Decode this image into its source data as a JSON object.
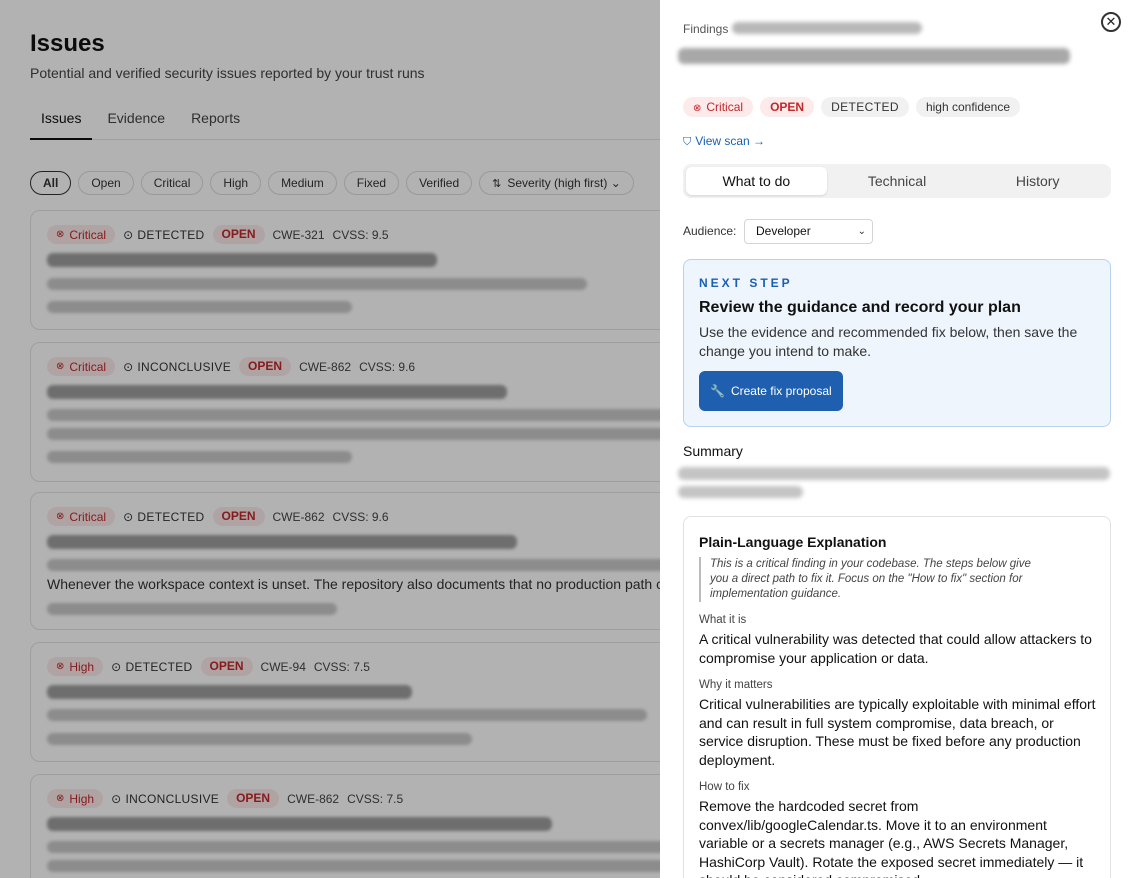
{
  "page": {
    "title": "Issues",
    "subtitle": "Potential and verified security issues reported by your trust runs",
    "tabs": [
      "Issues",
      "Evidence",
      "Reports"
    ],
    "filters": [
      "All",
      "Open",
      "Critical",
      "High",
      "Medium",
      "Fixed",
      "Verified"
    ],
    "sort_label": "Severity (high first)"
  },
  "cards": [
    {
      "severity": "Critical",
      "status": "DETECTED",
      "state": "OPEN",
      "cwe": "CWE-321",
      "cvss": "CVSS: 9.5"
    },
    {
      "severity": "Critical",
      "status": "INCONCLUSIVE",
      "state": "OPEN",
      "cwe": "CWE-862",
      "cvss": "CVSS: 9.6"
    },
    {
      "severity": "Critical",
      "status": "DETECTED",
      "state": "OPEN",
      "cwe": "CWE-862",
      "cvss": "CVSS: 9.6"
    },
    {
      "severity": "High",
      "status": "DETECTED",
      "state": "OPEN",
      "cwe": "CWE-94",
      "cvss": "CVSS: 7.5"
    },
    {
      "severity": "High",
      "status": "INCONCLUSIVE",
      "state": "OPEN",
      "cwe": "CWE-862",
      "cvss": "CVSS: 7.5"
    }
  ],
  "card3_visible_text": "Whenever the workspace context is unset. The repository also documents that no production path cu",
  "drawer": {
    "findings_label": "Findings",
    "badges": {
      "severity": "Critical",
      "state": "OPEN",
      "status": "DETECTED",
      "confidence": "high confidence"
    },
    "view_scan": "View scan →",
    "tabs": [
      "What to do",
      "Technical",
      "History"
    ],
    "audience_label": "Audience:",
    "audience_value": "Developer",
    "next_step": {
      "eyebrow": "NEXT STEP",
      "title": "Review the guidance and record your plan",
      "desc": "Use the evidence and recommended fix below, then save the change you intend to make.",
      "button": "Create fix proposal"
    },
    "summary_heading": "Summary",
    "explanation": {
      "title": "Plain-Language Explanation",
      "note": "This is a critical finding in your codebase. The steps below give you a direct path to fix it. Focus on the \"How to fix\" section for implementation guidance.",
      "what_label": "What it is",
      "what_body": "A critical vulnerability was detected that could allow attackers to compromise your application or data.",
      "why_label": "Why it matters",
      "why_body": "Critical vulnerabilities are typically exploitable with minimal effort and can result in full system compromise, data breach, or service disruption. These must be fixed before any production deployment.",
      "how_label": "How to fix",
      "how_body": "Remove the hardcoded secret from convex/lib/googleCalendar.ts. Move it to an environment variable or a secrets manager (e.g., AWS Secrets Manager, HashiCorp Vault). Rotate the exposed secret immediately — it should be considered compromised."
    }
  },
  "colors": {
    "accent": "#1e5fb0",
    "critical": "#c0282c",
    "critical_bg": "#fdeaea"
  }
}
